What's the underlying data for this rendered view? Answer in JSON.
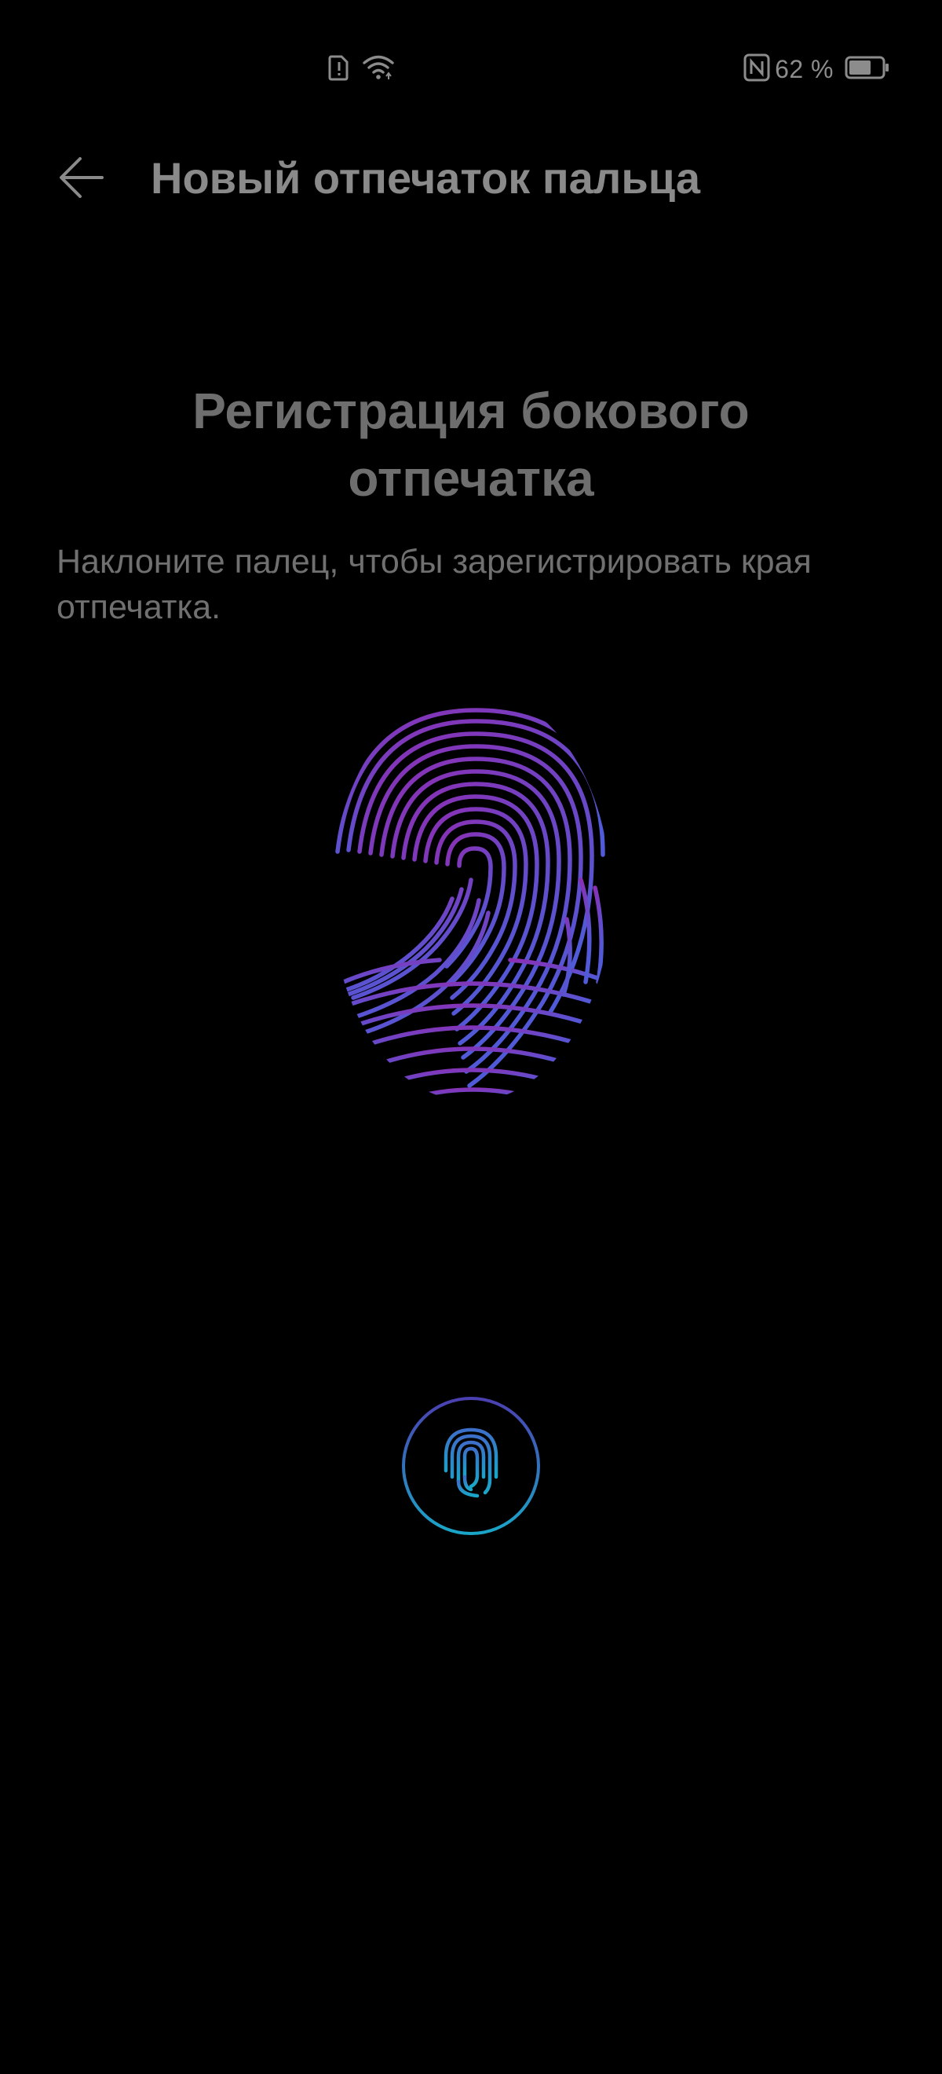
{
  "status_bar": {
    "battery_percent": "62 %",
    "icons": [
      "sim-alert-icon",
      "wifi-icon",
      "nfc-icon",
      "battery-icon"
    ]
  },
  "app_bar": {
    "title": "Новый отпечаток пальца",
    "back_icon": "arrow-left-icon"
  },
  "content": {
    "headline": "Регистрация бокового отпечатка",
    "instruction": "Наклоните палец, чтобы зарегистрировать края отпечатка."
  },
  "fingerprint": {
    "icon": "fingerprint-icon",
    "gradient_top": "#8b2fb3",
    "gradient_bottom": "#4f5bd8"
  },
  "sensor": {
    "icon": "fingerprint-sensor-icon",
    "ring_color_top": "#4b3fb0",
    "ring_color_bottom": "#1aa6c8"
  },
  "colors": {
    "background": "#000000",
    "text_primary": "#8a8a8a",
    "text_secondary": "#707070"
  }
}
